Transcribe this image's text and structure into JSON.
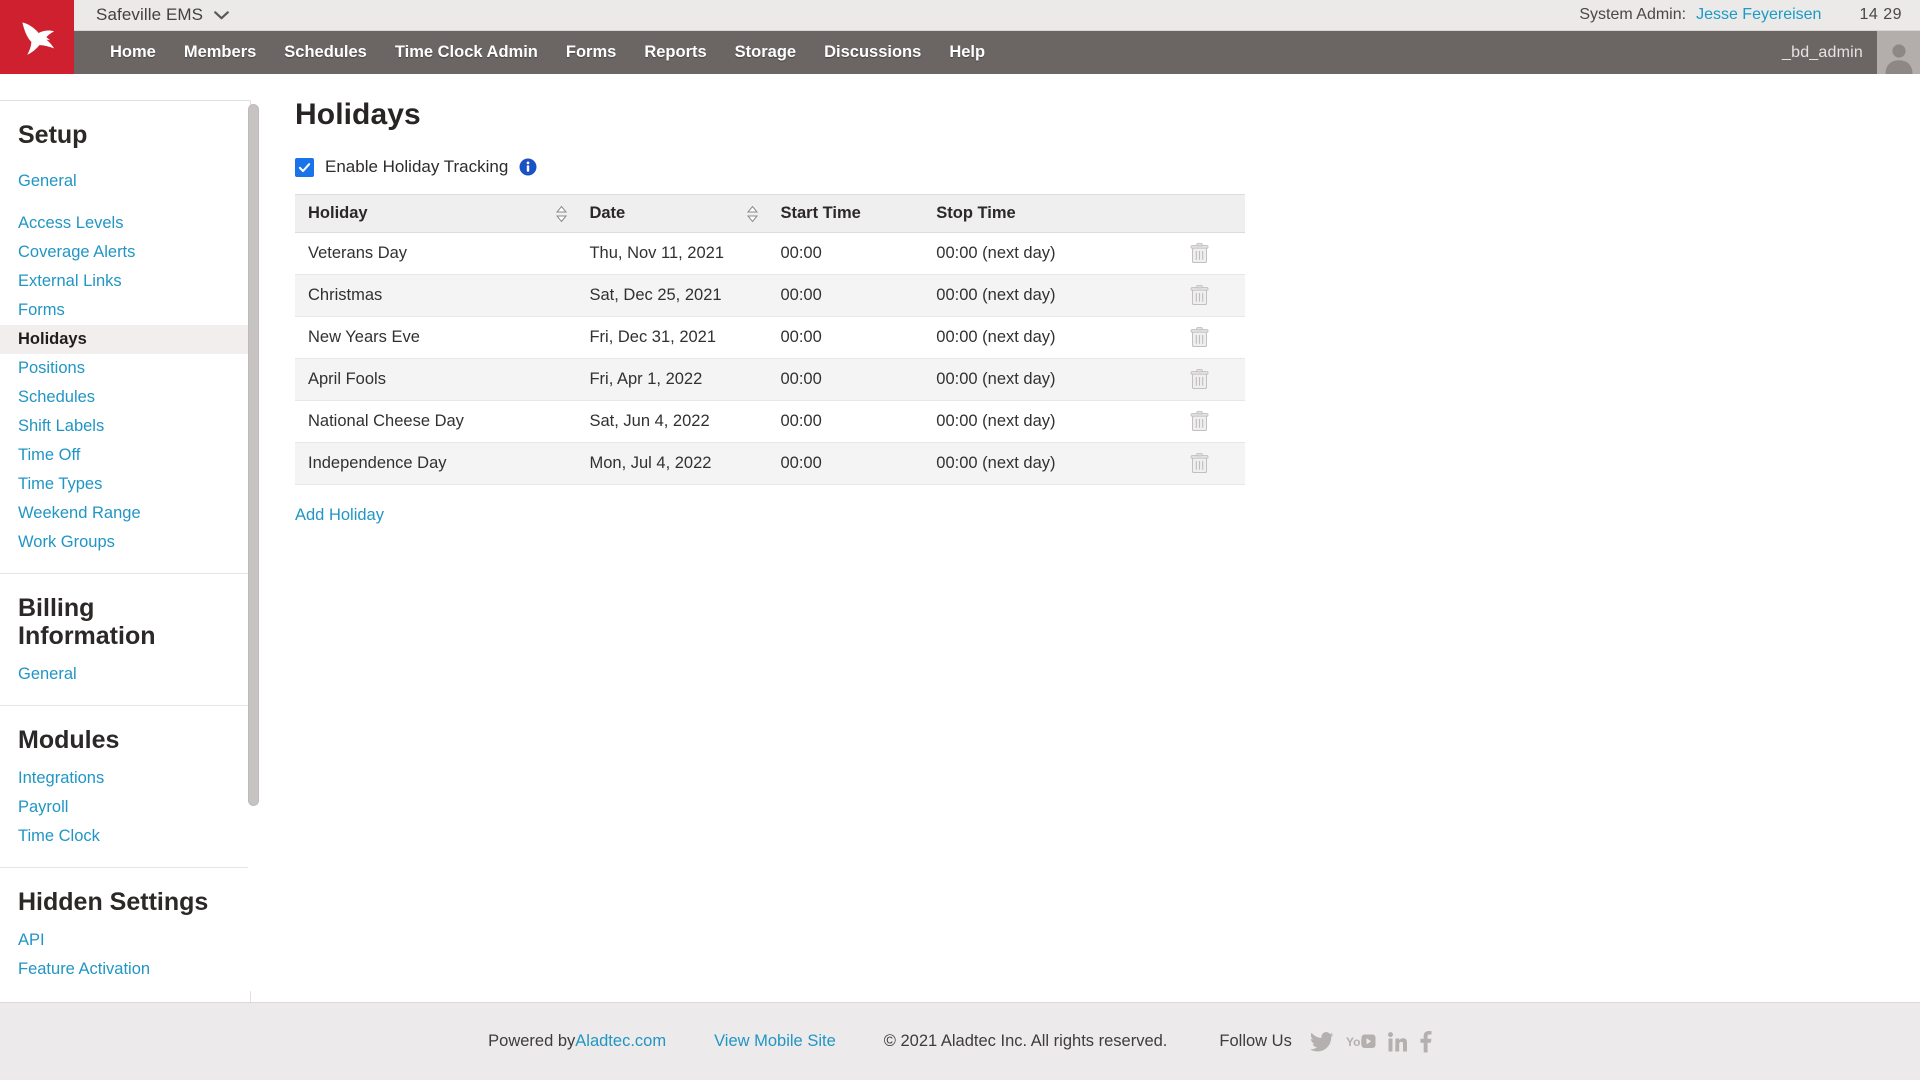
{
  "topbar": {
    "logo_icon": "hummingbird-logo-icon",
    "org_name": "Safeville EMS",
    "org_chevron_icon": "chevron-down-icon",
    "sysadmin_label": "System Admin:",
    "sysadmin_name": "Jesse Feyereisen",
    "clock": "14 29"
  },
  "nav": {
    "items": [
      {
        "label": "Home"
      },
      {
        "label": "Members"
      },
      {
        "label": "Schedules"
      },
      {
        "label": "Time Clock Admin"
      },
      {
        "label": "Forms"
      },
      {
        "label": "Reports"
      },
      {
        "label": "Storage"
      },
      {
        "label": "Discussions"
      },
      {
        "label": "Help"
      }
    ],
    "username": "_bd_admin",
    "avatar_icon": "user-avatar-icon"
  },
  "sidebar": {
    "sections": [
      {
        "title": "Setup",
        "links": [
          {
            "label": "General",
            "active": false,
            "spaced": true
          },
          {
            "label": "Access Levels",
            "active": false
          },
          {
            "label": "Coverage Alerts",
            "active": false
          },
          {
            "label": "External Links",
            "active": false
          },
          {
            "label": "Forms",
            "active": false
          },
          {
            "label": "Holidays",
            "active": true
          },
          {
            "label": "Positions",
            "active": false
          },
          {
            "label": "Schedules",
            "active": false
          },
          {
            "label": "Shift Labels",
            "active": false
          },
          {
            "label": "Time Off",
            "active": false
          },
          {
            "label": "Time Types",
            "active": false
          },
          {
            "label": "Weekend Range",
            "active": false
          },
          {
            "label": "Work Groups",
            "active": false
          }
        ]
      },
      {
        "title": "Billing Information",
        "links": [
          {
            "label": "General",
            "active": false
          }
        ]
      },
      {
        "title": "Modules",
        "links": [
          {
            "label": "Integrations",
            "active": false
          },
          {
            "label": "Payroll",
            "active": false
          },
          {
            "label": "Time Clock",
            "active": false
          }
        ]
      },
      {
        "title": "Hidden Settings",
        "links": [
          {
            "label": "API",
            "active": false
          },
          {
            "label": "Feature Activation",
            "active": false
          }
        ]
      }
    ]
  },
  "main": {
    "page_title": "Holidays",
    "enable_tracking": {
      "label": "Enable Holiday Tracking",
      "checked": true,
      "checkbox_icon": "checkmark-icon",
      "info_icon": "info-icon"
    },
    "table": {
      "columns": [
        {
          "label": "Holiday",
          "sortable": true,
          "link": true
        },
        {
          "label": "Date",
          "sortable": true,
          "link": true
        },
        {
          "label": "Start Time",
          "sortable": false,
          "link": false
        },
        {
          "label": "Stop Time",
          "sortable": false,
          "link": false
        },
        {
          "label": "",
          "sortable": false,
          "link": false
        }
      ],
      "sort_icon": "sort-updown-icon",
      "delete_icon": "trash-icon",
      "rows": [
        {
          "holiday": "Veterans Day",
          "date": "Thu, Nov 11, 2021",
          "start_time": "00:00",
          "stop_time": "00:00 (next day)"
        },
        {
          "holiday": "Christmas",
          "date": "Sat, Dec 25, 2021",
          "start_time": "00:00",
          "stop_time": "00:00 (next day)"
        },
        {
          "holiday": "New Years Eve",
          "date": "Fri, Dec 31, 2021",
          "start_time": "00:00",
          "stop_time": "00:00 (next day)"
        },
        {
          "holiday": "April Fools",
          "date": "Fri, Apr 1, 2022",
          "start_time": "00:00",
          "stop_time": "00:00 (next day)"
        },
        {
          "holiday": "National Cheese Day",
          "date": "Sat, Jun 4, 2022",
          "start_time": "00:00",
          "stop_time": "00:00 (next day)"
        },
        {
          "holiday": "Independence Day",
          "date": "Mon, Jul 4, 2022",
          "start_time": "00:00",
          "stop_time": "00:00 (next day)"
        }
      ]
    },
    "add_holiday_label": "Add Holiday"
  },
  "footer": {
    "powered_prefix": "Powered by ",
    "powered_link": "Aladtec.com",
    "mobile_link": "View Mobile Site",
    "copyright": "© 2021 Aladtec Inc. All rights reserved.",
    "follow_label": "Follow Us",
    "social": [
      {
        "name": "twitter-icon"
      },
      {
        "name": "youtube-icon"
      },
      {
        "name": "linkedin-icon"
      },
      {
        "name": "facebook-icon"
      }
    ]
  },
  "colors": {
    "brand_red": "#cf2030",
    "nav_gray": "#6b6564",
    "link_blue": "#2196c4",
    "checkbox_blue": "#1a73e8",
    "topbar_bg": "#ece9e9"
  }
}
